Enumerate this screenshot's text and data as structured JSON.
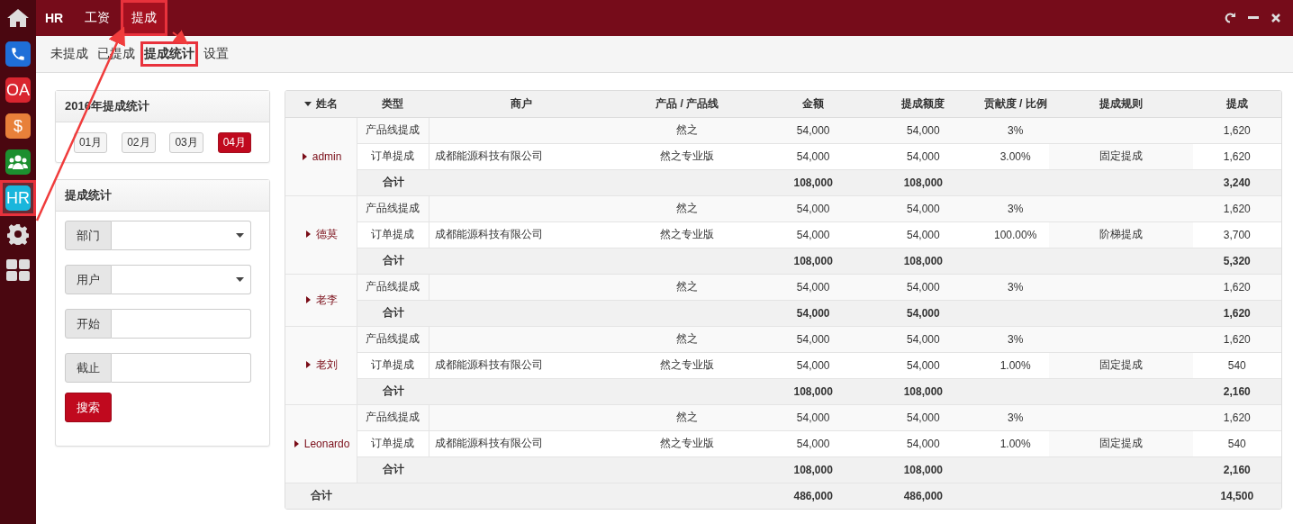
{
  "sidebar": {
    "items": [
      {
        "kind": "home",
        "selected": false,
        "highlighted": false
      },
      {
        "kind": "phone",
        "selected": false,
        "highlighted": false
      },
      {
        "kind": "text",
        "label": "OA",
        "color": "#d9252f",
        "selected": false,
        "highlighted": false
      },
      {
        "kind": "text",
        "label": "$",
        "color": "#e8803a",
        "selected": false,
        "highlighted": false
      },
      {
        "kind": "people",
        "selected": false,
        "highlighted": false
      },
      {
        "kind": "text",
        "label": "HR",
        "color": "#1ab6dc",
        "selected": true,
        "highlighted": true
      },
      {
        "kind": "gear",
        "selected": false,
        "highlighted": false
      },
      {
        "kind": "grid",
        "selected": false,
        "highlighted": false
      }
    ]
  },
  "topbar": {
    "brand": "HR",
    "tabs": [
      {
        "label": "工资",
        "selected": false,
        "highlighted": false
      },
      {
        "label": "提成",
        "selected": true,
        "highlighted": true
      }
    ]
  },
  "subnav": [
    {
      "label": "未提成",
      "selected": false,
      "highlighted": false
    },
    {
      "label": "已提成",
      "selected": false,
      "highlighted": false
    },
    {
      "label": "提成统计",
      "selected": true,
      "highlighted": true
    },
    {
      "label": "设置",
      "selected": false,
      "highlighted": false
    }
  ],
  "months_card": {
    "title": "2016年提成统计",
    "months": [
      {
        "label": "01月",
        "selected": false
      },
      {
        "label": "02月",
        "selected": false
      },
      {
        "label": "03月",
        "selected": false
      },
      {
        "label": "04月",
        "selected": true
      }
    ]
  },
  "filter_card": {
    "title": "提成统计",
    "fields": [
      {
        "label": "部门",
        "kind": "select"
      },
      {
        "label": "用户",
        "kind": "select"
      },
      {
        "label": "开始",
        "kind": "input"
      },
      {
        "label": "截止",
        "kind": "input"
      }
    ],
    "button": "搜索"
  },
  "table": {
    "columns": [
      "姓名",
      "类型",
      "商户",
      "产品 / 产品线",
      "金额",
      "提成额度",
      "贡献度 / 比例",
      "提成规则",
      "提成"
    ],
    "groups": [
      {
        "name": "admin",
        "rows": [
          {
            "type": "产品线提成",
            "merchant": "",
            "product": "然之",
            "amount": "54,000",
            "base": "54,000",
            "ratio": "3%",
            "rule": "",
            "commission": "1,620"
          },
          {
            "type": "订单提成",
            "merchant": "成都能源科技有限公司",
            "product": "然之专业版",
            "amount": "54,000",
            "base": "54,000",
            "ratio": "3.00%",
            "rule": "固定提成",
            "commission": "1,620"
          }
        ],
        "total": {
          "label": "合计",
          "amount": "108,000",
          "base": "108,000",
          "commission": "3,240"
        }
      },
      {
        "name": "德莫",
        "rows": [
          {
            "type": "产品线提成",
            "merchant": "",
            "product": "然之",
            "amount": "54,000",
            "base": "54,000",
            "ratio": "3%",
            "rule": "",
            "commission": "1,620"
          },
          {
            "type": "订单提成",
            "merchant": "成都能源科技有限公司",
            "product": "然之专业版",
            "amount": "54,000",
            "base": "54,000",
            "ratio": "100.00%",
            "rule": "阶梯提成",
            "commission": "3,700"
          }
        ],
        "total": {
          "label": "合计",
          "amount": "108,000",
          "base": "108,000",
          "commission": "5,320"
        }
      },
      {
        "name": "老李",
        "rows": [
          {
            "type": "产品线提成",
            "merchant": "",
            "product": "然之",
            "amount": "54,000",
            "base": "54,000",
            "ratio": "3%",
            "rule": "",
            "commission": "1,620"
          }
        ],
        "total": {
          "label": "合计",
          "amount": "54,000",
          "base": "54,000",
          "commission": "1,620"
        }
      },
      {
        "name": "老刘",
        "rows": [
          {
            "type": "产品线提成",
            "merchant": "",
            "product": "然之",
            "amount": "54,000",
            "base": "54,000",
            "ratio": "3%",
            "rule": "",
            "commission": "1,620"
          },
          {
            "type": "订单提成",
            "merchant": "成都能源科技有限公司",
            "product": "然之专业版",
            "amount": "54,000",
            "base": "54,000",
            "ratio": "1.00%",
            "rule": "固定提成",
            "commission": "540"
          }
        ],
        "total": {
          "label": "合计",
          "amount": "108,000",
          "base": "108,000",
          "commission": "2,160"
        }
      },
      {
        "name": "Leonardo",
        "rows": [
          {
            "type": "产品线提成",
            "merchant": "",
            "product": "然之",
            "amount": "54,000",
            "base": "54,000",
            "ratio": "3%",
            "rule": "",
            "commission": "1,620"
          },
          {
            "type": "订单提成",
            "merchant": "成都能源科技有限公司",
            "product": "然之专业版",
            "amount": "54,000",
            "base": "54,000",
            "ratio": "1.00%",
            "rule": "固定提成",
            "commission": "540"
          }
        ],
        "total": {
          "label": "合计",
          "amount": "108,000",
          "base": "108,000",
          "commission": "2,160"
        }
      }
    ],
    "grand_total": {
      "label": "合计",
      "amount": "486,000",
      "base": "486,000",
      "commission": "14,500"
    }
  }
}
